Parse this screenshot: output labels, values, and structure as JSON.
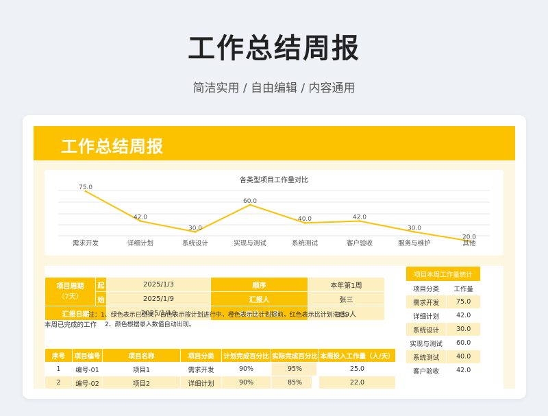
{
  "hero": {
    "title": "工作总结周报",
    "subtitle": "简洁实用 / 自由编辑 / 内容通用"
  },
  "banner": {
    "title": "工作总结周报"
  },
  "chart_data": {
    "type": "line",
    "title": "各类型项目工作量对比",
    "categories": [
      "需求开发",
      "详细计划",
      "系统设计",
      "实现与测试",
      "系统测试",
      "客户验收",
      "服务与维护",
      "其他"
    ],
    "values": [
      75.0,
      42.0,
      30.0,
      60.0,
      40.0,
      42.0,
      30.0,
      20.0
    ],
    "value_labels": [
      "75.0",
      "42.0",
      "30.0",
      "60.0",
      "40.0",
      "42.0",
      "30.0",
      "20.0"
    ],
    "grid": true,
    "color": "#fcc200"
  },
  "info": {
    "period_label": "项目周期",
    "period_days": "（7天）",
    "start_label": "起",
    "end_label": "始",
    "start_date": "2025/1/3",
    "end_date": "2025/1/9",
    "seq_label": "顺序",
    "seq_value": "本年第1周",
    "reporter_label": "汇报人",
    "reporter_value": "张三",
    "report_date_label": "汇报日期",
    "report_date_value": "2025/1/10",
    "input_label": "本周投入人数",
    "input_value": "339人"
  },
  "notes": {
    "label": "本周已完成的工作",
    "line1": "注：1、绿色表示已结束，白色表示按计划进行中，橙色表示比计划提前，红色表示比计划滞后。",
    "line2": "2、颜色根据录入数值自动出现。"
  },
  "table": {
    "headers": [
      "序号",
      "项目编号",
      "项目名称",
      "项目分类",
      "计划完成百分比",
      "实际完成百分比",
      "本周投入工作量（人/天）"
    ],
    "rows": [
      {
        "no": "1",
        "code": "编号-01",
        "name": "项目1",
        "category": "需求开发",
        "plan": "90%",
        "actual": "95%",
        "actual_fill": 0.95,
        "workload": "25.0"
      },
      {
        "no": "2",
        "code": "编号-02",
        "name": "项目2",
        "category": "详细计划",
        "plan": "90%",
        "actual": "85%",
        "actual_fill": 0.85,
        "workload": "22.0"
      }
    ]
  },
  "side": {
    "title": "项目本周工作量统计",
    "col1": "项目分类",
    "col2": "工作量",
    "rows": [
      {
        "cat": "需求开发",
        "val": "75.0"
      },
      {
        "cat": "详细计划",
        "val": "42.0"
      },
      {
        "cat": "系统设计",
        "val": "30.0"
      },
      {
        "cat": "实现与测试",
        "val": "60.0"
      },
      {
        "cat": "系统测试",
        "val": "40.0"
      },
      {
        "cat": "客户验收",
        "val": "42.0"
      }
    ]
  }
}
